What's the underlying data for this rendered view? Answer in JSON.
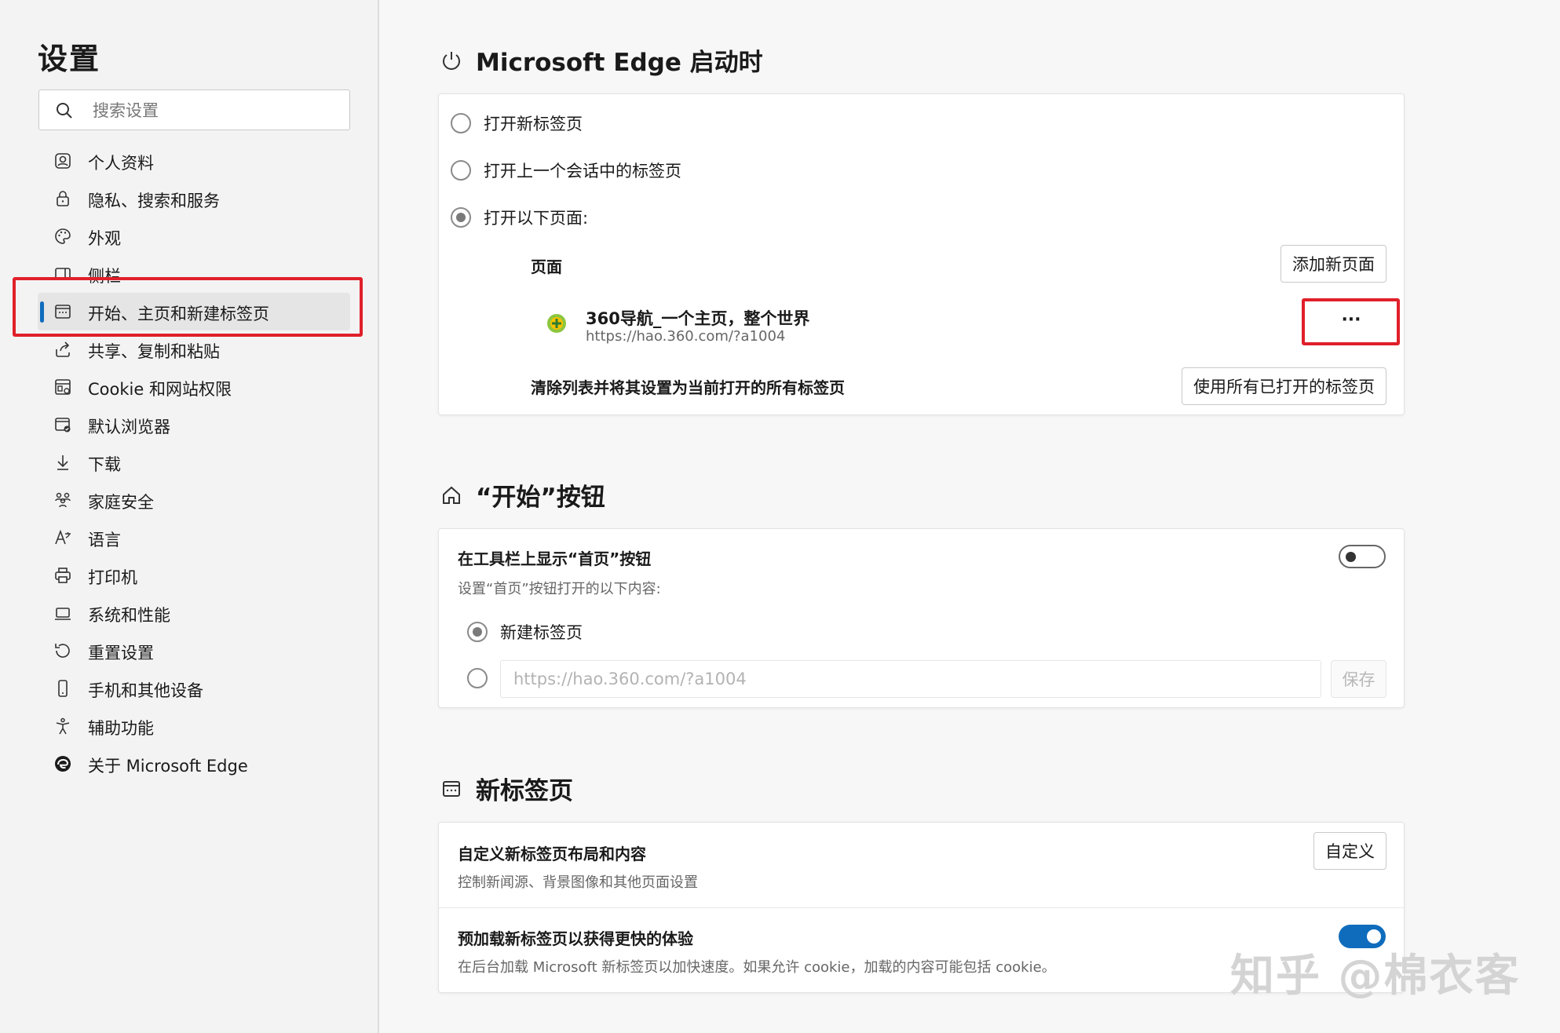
{
  "sidebar": {
    "title": "设置",
    "search_placeholder": "搜索设置",
    "items": [
      {
        "label": "个人资料",
        "icon": "profile-icon"
      },
      {
        "label": "隐私、搜索和服务",
        "icon": "lock-icon"
      },
      {
        "label": "外观",
        "icon": "palette-icon"
      },
      {
        "label": "侧栏",
        "icon": "sidebar-icon"
      },
      {
        "label": "开始、主页和新建标签页",
        "icon": "home-page-icon",
        "active": true
      },
      {
        "label": "共享、复制和粘贴",
        "icon": "share-icon"
      },
      {
        "label": "Cookie 和网站权限",
        "icon": "site-permissions-icon"
      },
      {
        "label": "默认浏览器",
        "icon": "default-browser-icon"
      },
      {
        "label": "下载",
        "icon": "download-icon"
      },
      {
        "label": "家庭安全",
        "icon": "family-icon"
      },
      {
        "label": "语言",
        "icon": "language-icon"
      },
      {
        "label": "打印机",
        "icon": "printer-icon"
      },
      {
        "label": "系统和性能",
        "icon": "laptop-icon"
      },
      {
        "label": "重置设置",
        "icon": "reset-icon"
      },
      {
        "label": "手机和其他设备",
        "icon": "phone-icon"
      },
      {
        "label": "辅助功能",
        "icon": "accessibility-icon"
      },
      {
        "label": "关于 Microsoft Edge",
        "icon": "edge-logo-icon"
      }
    ]
  },
  "startup": {
    "title": "Microsoft Edge 启动时",
    "options": [
      "打开新标签页",
      "打开上一个会话中的标签页",
      "打开以下页面:"
    ],
    "selected_index": 2,
    "pages_label": "页面",
    "add_page_button": "添加新页面",
    "page_entry": {
      "title": "360导航_一个主页，整个世界",
      "url": "https://hao.360.com/?a1004"
    },
    "more_button": "···",
    "clear_label": "清除列表并将其设置为当前打开的所有标签页",
    "use_open_tabs_button": "使用所有已打开的标签页"
  },
  "home_button": {
    "title": "“开始”按钮",
    "show_label": "在工具栏上显示“首页”按钮",
    "show_toggle": "off",
    "sub_label": "设置“首页”按钮打开的以下内容:",
    "option_new_tab": "新建标签页",
    "url_placeholder": "https://hao.360.com/?a1004",
    "save_button": "保存"
  },
  "new_tab": {
    "title": "新标签页",
    "customize_label": "自定义新标签页布局和内容",
    "customize_sub": "控制新闻源、背景图像和其他页面设置",
    "customize_button": "自定义",
    "preload_label": "预加载新标签页以获得更快的体验",
    "preload_sub": "在后台加载 Microsoft 新标签页以加快速度。如果允许 cookie，加载的内容可能包括 cookie。",
    "preload_toggle": "on"
  },
  "watermark": "知乎 @棉衣客",
  "colors": {
    "accent": "#0f6cbd",
    "highlight_border": "#e0202a"
  }
}
